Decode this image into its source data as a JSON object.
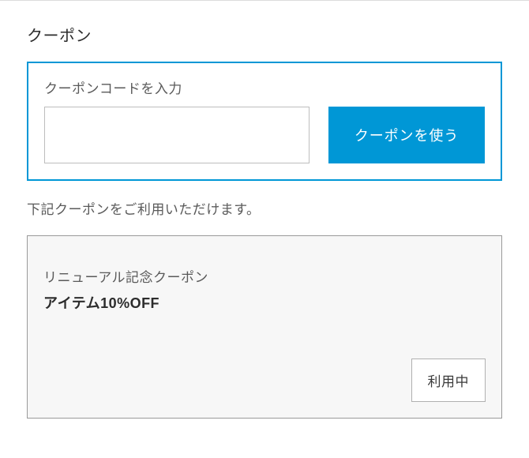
{
  "section_title": "クーポン",
  "entry": {
    "label": "クーポンコードを入力",
    "input_value": "",
    "apply_button": "クーポンを使う"
  },
  "available_text": "下記クーポンをご利用いただけます。",
  "coupons": [
    {
      "name": "リニューアル記念クーポン",
      "benefit": "アイテム10%OFF",
      "status": "利用中"
    }
  ]
}
